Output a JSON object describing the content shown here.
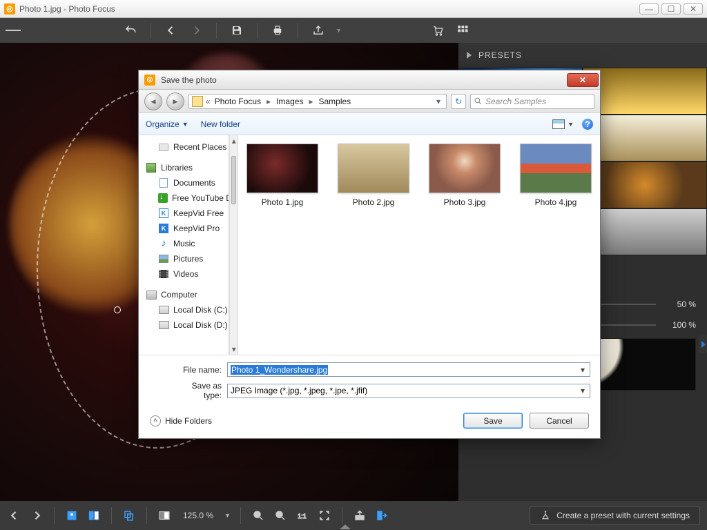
{
  "app": {
    "title": "Photo 1.jpg - Photo Focus"
  },
  "presets": {
    "header": "PRESETS"
  },
  "sliders": {
    "value1": "50 %",
    "value2": "100 %"
  },
  "bottom": {
    "zoom": "125.0 %",
    "create_preset": "Create a preset with current settings"
  },
  "dialog": {
    "title": "Save the photo",
    "breadcrumbs": [
      "Photo Focus",
      "Images",
      "Samples"
    ],
    "search_placeholder": "Search Samples",
    "organize": "Organize",
    "new_folder": "New folder",
    "tree": {
      "recent_places": "Recent Places",
      "libraries": "Libraries",
      "documents": "Documents",
      "free_yt": "Free YouTube Down",
      "keepvid_free": "KeepVid Free",
      "keepvid_pro": "KeepVid Pro",
      "music": "Music",
      "pictures": "Pictures",
      "videos": "Videos",
      "computer": "Computer",
      "disk_c": "Local Disk (C:)",
      "disk_d": "Local Disk (D:)"
    },
    "files": [
      "Photo 1.jpg",
      "Photo 2.jpg",
      "Photo 3.jpg",
      "Photo 4.jpg"
    ],
    "filename_label": "File name:",
    "filename_value": "Photo 1_Wondershare.jpg",
    "saveas_label": "Save as type:",
    "saveas_value": "JPEG Image (*.jpg, *.jpeg, *.jpe, *.jfif)",
    "hide_folders": "Hide Folders",
    "save": "Save",
    "cancel": "Cancel"
  }
}
